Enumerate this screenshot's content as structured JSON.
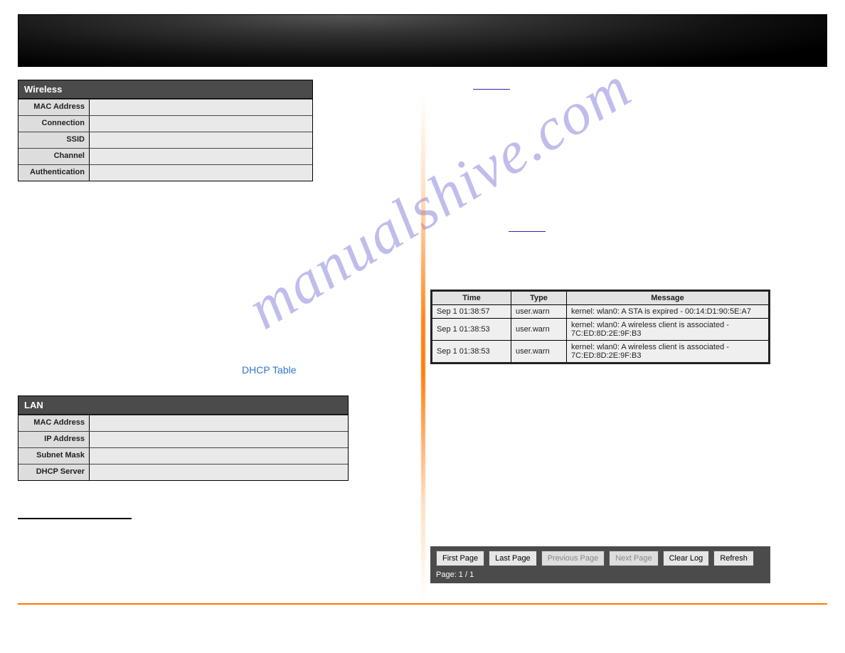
{
  "wireless": {
    "title": "Wireless",
    "rows": [
      {
        "label": "MAC Address",
        "value": ""
      },
      {
        "label": "Connection",
        "value": ""
      },
      {
        "label": "SSID",
        "value": ""
      },
      {
        "label": "Channel",
        "value": ""
      },
      {
        "label": "Authentication",
        "value": ""
      }
    ]
  },
  "dhcp_link": "DHCP Table",
  "lan": {
    "title": "LAN",
    "rows": [
      {
        "label": "MAC Address",
        "value": ""
      },
      {
        "label": "IP Address",
        "value": ""
      },
      {
        "label": "Subnet Mask",
        "value": ""
      },
      {
        "label": "DHCP Server",
        "value": ""
      }
    ]
  },
  "log": {
    "headers": {
      "time": "Time",
      "type": "Type",
      "message": "Message"
    },
    "rows": [
      {
        "time": "Sep 1 01:38:57",
        "type": "user.warn",
        "message": "kernel: wlan0: A STA is expired - 00:14:D1:90:5E:A7"
      },
      {
        "time": "Sep 1 01:38:53",
        "type": "user.warn",
        "message": "kernel: wlan0: A wireless client is associated - 7C:ED:8D:2E:9F:B3"
      },
      {
        "time": "Sep 1 01:38:53",
        "type": "user.warn",
        "message": "kernel: wlan0: A wireless client is associated - 7C:ED:8D:2E:9F:B3"
      }
    ]
  },
  "pager": {
    "first": "First Page",
    "last": "Last Page",
    "prev": "Previous Page",
    "next": "Next Page",
    "clear": "Clear Log",
    "refresh": "Refresh",
    "page_label": "Page: 1 / 1"
  },
  "watermark": "manualshive.com"
}
